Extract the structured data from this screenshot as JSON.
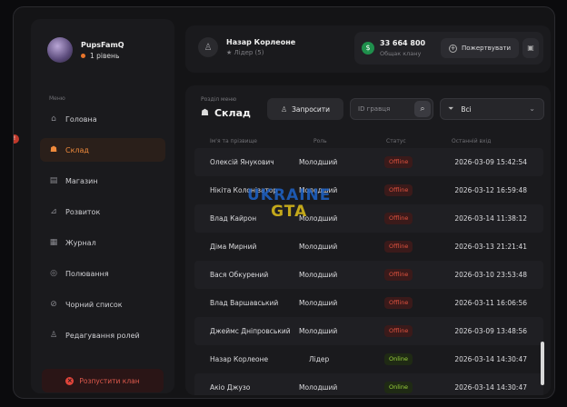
{
  "sidebar": {
    "user": {
      "name": "PupsFamQ",
      "level": "1 рівень"
    },
    "menu_label": "Меню",
    "items": [
      {
        "label": "Головна",
        "icon": "home-icon"
      },
      {
        "label": "Склад",
        "icon": "people-icon",
        "active": true
      },
      {
        "label": "Магазин",
        "icon": "shop-icon"
      },
      {
        "label": "Розвиток",
        "icon": "chart-icon"
      },
      {
        "label": "Журнал",
        "icon": "journal-icon"
      },
      {
        "label": "Полювання",
        "icon": "target-icon"
      },
      {
        "label": "Чорний список",
        "icon": "ban-icon"
      },
      {
        "label": "Редагування ролей",
        "icon": "user-edit-icon"
      }
    ],
    "disband_label": "Розпустити клан"
  },
  "header": {
    "leader_name": "Назар Корлеоне",
    "leader_role": "Лідер (5)",
    "balance": "33 664 800",
    "balance_sub": "Общак клану",
    "donate_label": "Пожертвувати"
  },
  "panel": {
    "subtitle": "Розділ меню",
    "title": "Склад",
    "invite_label": "Запросити",
    "search_placeholder": "ID гравця",
    "filter_value": "Всі",
    "columns": [
      "Ім'я та прізвище",
      "Роль",
      "Статус",
      "Останній вхід"
    ],
    "rows": [
      {
        "name": "Олексій Янукович",
        "role": "Молодший",
        "status": "Offline",
        "date": "2026-03-09 15:42:54"
      },
      {
        "name": "Нікіта Колонізатор",
        "role": "Молодший",
        "status": "Offline",
        "date": "2026-03-12 16:59:48"
      },
      {
        "name": "Влад Кайрон",
        "role": "Молодший",
        "status": "Offline",
        "date": "2026-03-14 11:38:12"
      },
      {
        "name": "Діма Мирний",
        "role": "Молодший",
        "status": "Offline",
        "date": "2026-03-13 21:21:41"
      },
      {
        "name": "Вася Обкурений",
        "role": "Молодший",
        "status": "Offline",
        "date": "2026-03-10 23:53:48"
      },
      {
        "name": "Влад Варшавський",
        "role": "Молодший",
        "status": "Offline",
        "date": "2026-03-11 16:06:56"
      },
      {
        "name": "Джеймс Дніпровський",
        "role": "Молодший",
        "status": "Offline",
        "date": "2026-03-09 13:48:56"
      },
      {
        "name": "Назар Корлеоне",
        "role": "Лідер",
        "status": "Online",
        "date": "2026-03-14 14:30:47"
      },
      {
        "name": "Акіо Джузо",
        "role": "Молодший",
        "status": "Online",
        "date": "2026-03-14 14:30:47"
      }
    ]
  },
  "watermark": {
    "line1": "UKRAINE",
    "line2": "GTA"
  },
  "colors": {
    "accent": "#ef8a3c",
    "offline": "#e0523f",
    "online": "#9bd33c",
    "money": "#1f8f4c"
  }
}
